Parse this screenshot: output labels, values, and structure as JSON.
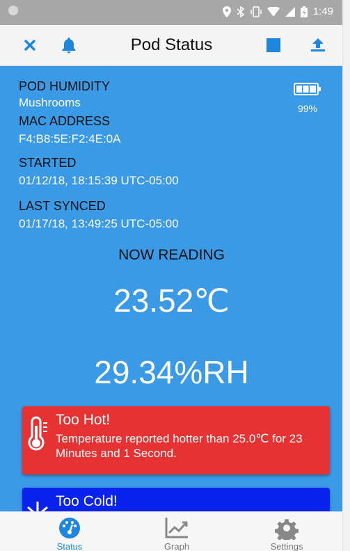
{
  "status_bar": {
    "time": "1:49"
  },
  "toolbar": {
    "title": "Pod Status"
  },
  "pod": {
    "humidity_label": "POD HUMIDITY",
    "humidity_value": "Mushrooms",
    "mac_label": "MAC ADDRESS",
    "mac_value": "F4:B8:5E:F2:4E:0A",
    "started_label": "STARTED",
    "started_value": "01/12/18, 18:15:39 UTC-05:00",
    "synced_label": "LAST SYNCED",
    "synced_value": "01/17/18, 13:49:25 UTC-05:00",
    "battery_pct": "99%"
  },
  "reading": {
    "title": "NOW READING",
    "temperature": "23.52℃",
    "humidity": "29.34%RH"
  },
  "alerts": [
    {
      "title": "Too Hot!",
      "message": "Temperature reported hotter than 25.0℃ for 23 Minutes and 1 Second.",
      "color": "#e63232"
    },
    {
      "title": "Too Cold!",
      "message": "",
      "color": "#0a22ee"
    }
  ],
  "nav": {
    "status": "Status",
    "graph": "Graph",
    "settings": "Settings"
  },
  "colors": {
    "accent": "#1f86e0",
    "main_bg": "#3a9ae6"
  }
}
